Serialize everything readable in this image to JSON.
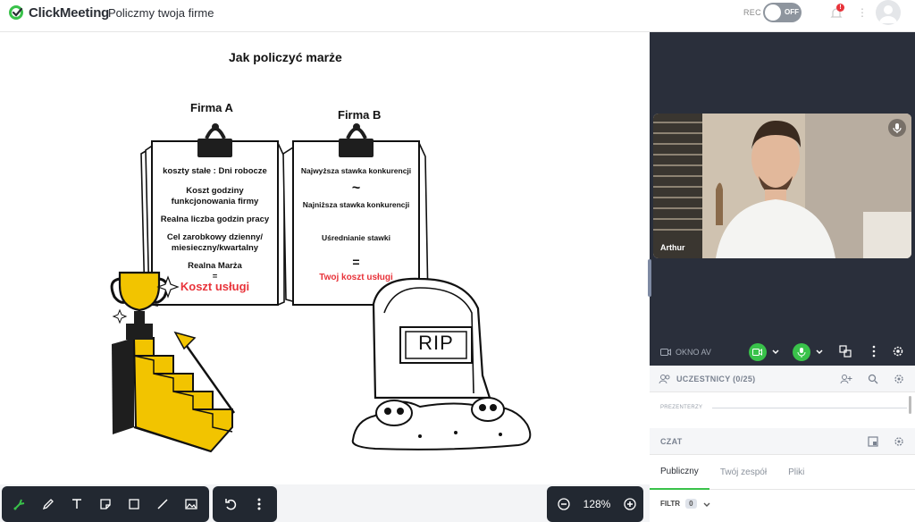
{
  "app": {
    "logo_text": "ClickMeeting",
    "room_title": "Policzmy twoja firme",
    "rec_label": "REC",
    "rec_toggle": "OFF",
    "notif_badge": "!"
  },
  "board": {
    "title": "Jak policzyć marże",
    "firma_a": {
      "heading": "Firma A",
      "lines": [
        "koszty stałe : Dni robocze",
        "Koszt godziny funkcjonowania firmy",
        "Realna liczba godzin pracy",
        "Cel zarobkowy dzienny/ miesieczny/kwartalny",
        "Realna Marża",
        "=",
        "Koszt usługi"
      ]
    },
    "firma_b": {
      "heading": "Firma B",
      "lines": [
        "Najwyższa stawka konkurencji",
        "~",
        "Najniższa stawka konkurencji",
        "Uśrednianie stawki",
        "=",
        "Twoj koszt usługi"
      ]
    },
    "tombstone_text": "RIP"
  },
  "toolbar": {
    "zoom_label": "128%"
  },
  "video": {
    "presenter_name": "Arthur"
  },
  "panel": {
    "av_label": "OKNO AV",
    "participants_label": "UCZESTNICY (0/25)",
    "presenters_label": "PREZENTERZY",
    "chat_label": "CZAT",
    "tabs": [
      "Publiczny",
      "Twój zespół",
      "Pliki"
    ],
    "filter_label": "FILTR",
    "filter_count": "0"
  },
  "colors": {
    "accent_green": "#39c24a",
    "highlight_red": "#e8333a",
    "dark_toolbar": "#222831",
    "video_bg": "#2a2f3b"
  }
}
